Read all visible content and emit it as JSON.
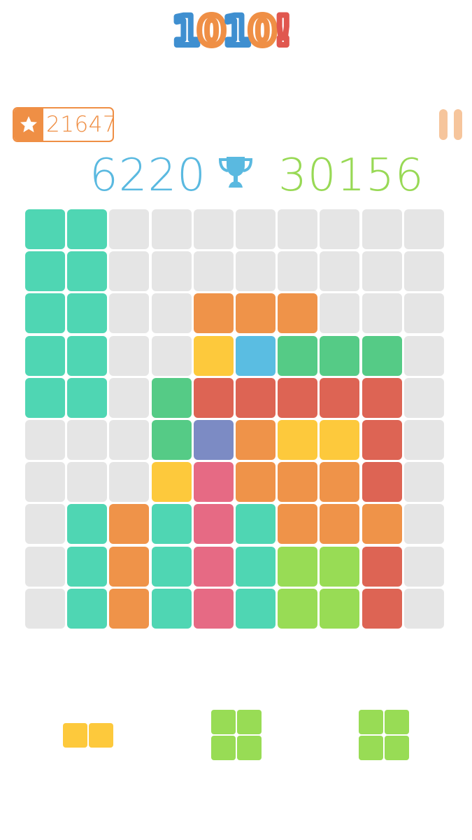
{
  "logo": {
    "text": "1010!",
    "colors": [
      "#3f8fd0",
      "#ef8f45",
      "#3f8fd0",
      "#ef8f45",
      "#e0574f"
    ]
  },
  "stars": {
    "count": "21647",
    "color": "#ef8f45"
  },
  "pause": {
    "icon": "pause-icon",
    "color": "#f6c59c"
  },
  "scores": {
    "current": "6220",
    "current_color": "#5ab9e0",
    "best": "30156",
    "best_color": "#98d955",
    "trophy_icon": "trophy-icon",
    "trophy_color": "#5ab9e0"
  },
  "palette": {
    ".": "#e5e5e5",
    "T": "#4fd6b3",
    "O": "#ef9349",
    "Y": "#fdc93c",
    "B": "#5abde2",
    "G": "#55cb86",
    "R": "#dd6454",
    "P": "#7c8bc4",
    "K": "#e66a84",
    "L": "#98dc55"
  },
  "board": [
    "TT........",
    "TT........",
    "TT..OOO...",
    "TT..YBGGG.",
    "TT.GRRRRR.",
    "...GPOYYR.",
    "...YKOOOR.",
    ".TOTKTOOO.",
    ".TOTKTLLR.",
    ".TOTKTLLR."
  ],
  "tray": [
    {
      "name": "tray-piece-yellow-1x2",
      "color": "Y",
      "rows": [
        "XX"
      ]
    },
    {
      "name": "tray-piece-green-2x2-a",
      "color": "L",
      "rows": [
        "XX",
        "XX"
      ]
    },
    {
      "name": "tray-piece-green-2x2-b",
      "color": "L",
      "rows": [
        "XX",
        "XX"
      ]
    }
  ]
}
